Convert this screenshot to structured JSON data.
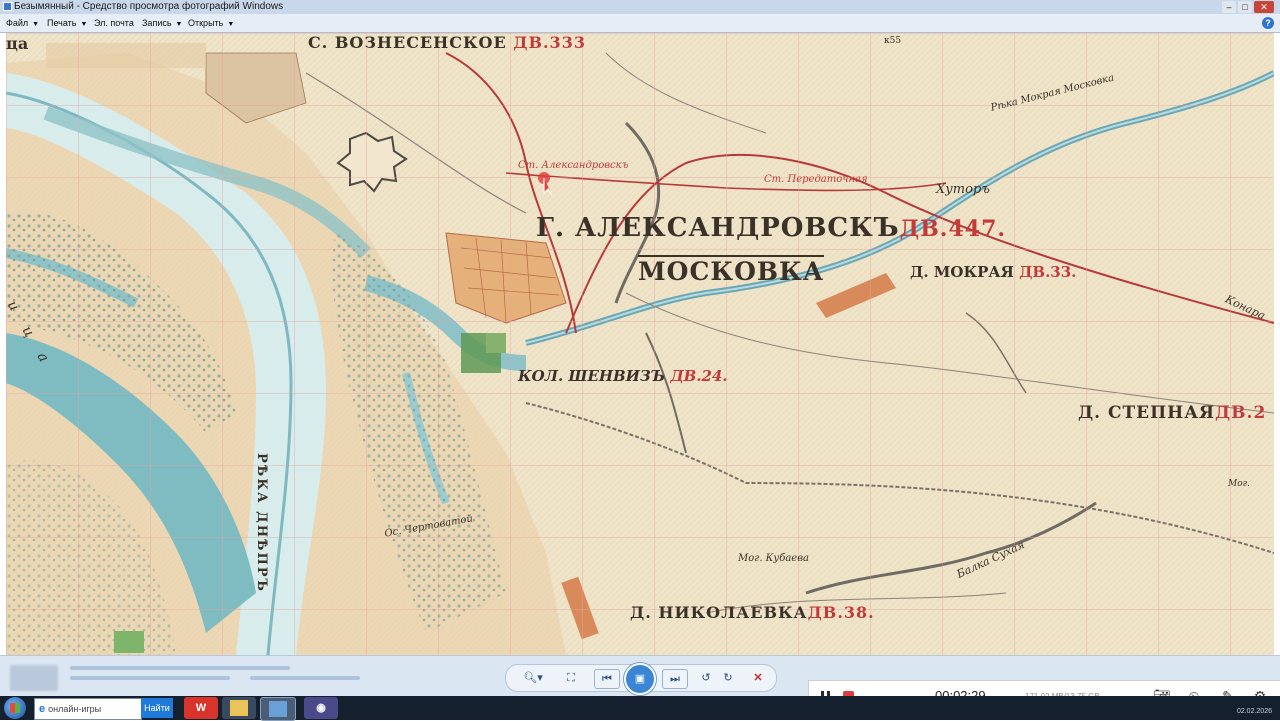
{
  "window": {
    "title": "Безымянный - Средство просмотра фотографий Windows"
  },
  "menu": {
    "file": "Файл",
    "print": "Печать",
    "email": "Эл. почта",
    "record": "Запись",
    "open": "Открыть",
    "help": "?"
  },
  "map": {
    "labels": {
      "voznesenskoe": "С. ВОЗНЕСЕНСКОЕ",
      "voznesenskoe_dv": "ДВ.333",
      "tsa": "ца",
      "sheet_num": "к55",
      "aleksandrovsk": "Г. АЛЕКСАНДРОВСКЪ",
      "aleksandrovsk_dv": "ДВ.447.",
      "moskovka": "МОСКОВКА",
      "station_aleksandrovsk": "Ст. Александровскъ",
      "station_peredatochnaya": "Ст. Передаточная",
      "khutor": "Хуторъ",
      "mokraya": "Д. МОКРАЯ",
      "mokraya_dv": "ДВ.33.",
      "mokraya_moskovka": "Рѣка Мокрая Московка",
      "kolonia": "КОЛ. ШЕНВИЗЪ",
      "kolonia_dv": "ДВ.24.",
      "stepnaya": "Д. СТЕПНАЯ",
      "stepnaya_dv": "ДВ.2",
      "dnepr": "РѢКА ДНѢПРЪ",
      "nikolaevka": "Д. НИКОЛАЕВКА",
      "nikolaevka_dv": "ДВ.38.",
      "mog_kubaeva": "Мог. Кубаева",
      "balka_sukhaya": "Балка Сухая",
      "ostrov_chertovatoy": "Ос. Чертоватой",
      "balka_konara": "Конара",
      "mog": "Мог.",
      "khortitsa_part": "р т и ц а"
    }
  },
  "viewer_controls": {
    "zoom": "zoom",
    "fit": "fit",
    "prev": "prev",
    "slideshow": "slideshow",
    "next": "next",
    "rotate_ccw": "rotate-ccw",
    "rotate_cw": "rotate-cw",
    "delete": "delete"
  },
  "recorder": {
    "time": "00:02:29",
    "size": "171.02 MB/13.75 GB"
  },
  "taskbar": {
    "search_placeholder": "онлайн-игры",
    "search_button": "Найти",
    "date": "02.02.2026"
  },
  "colors": {
    "accent": "#3a86d4",
    "map_paper": "#efe3c8",
    "map_water": "#8fc3c7",
    "map_red": "#c23a3a"
  }
}
